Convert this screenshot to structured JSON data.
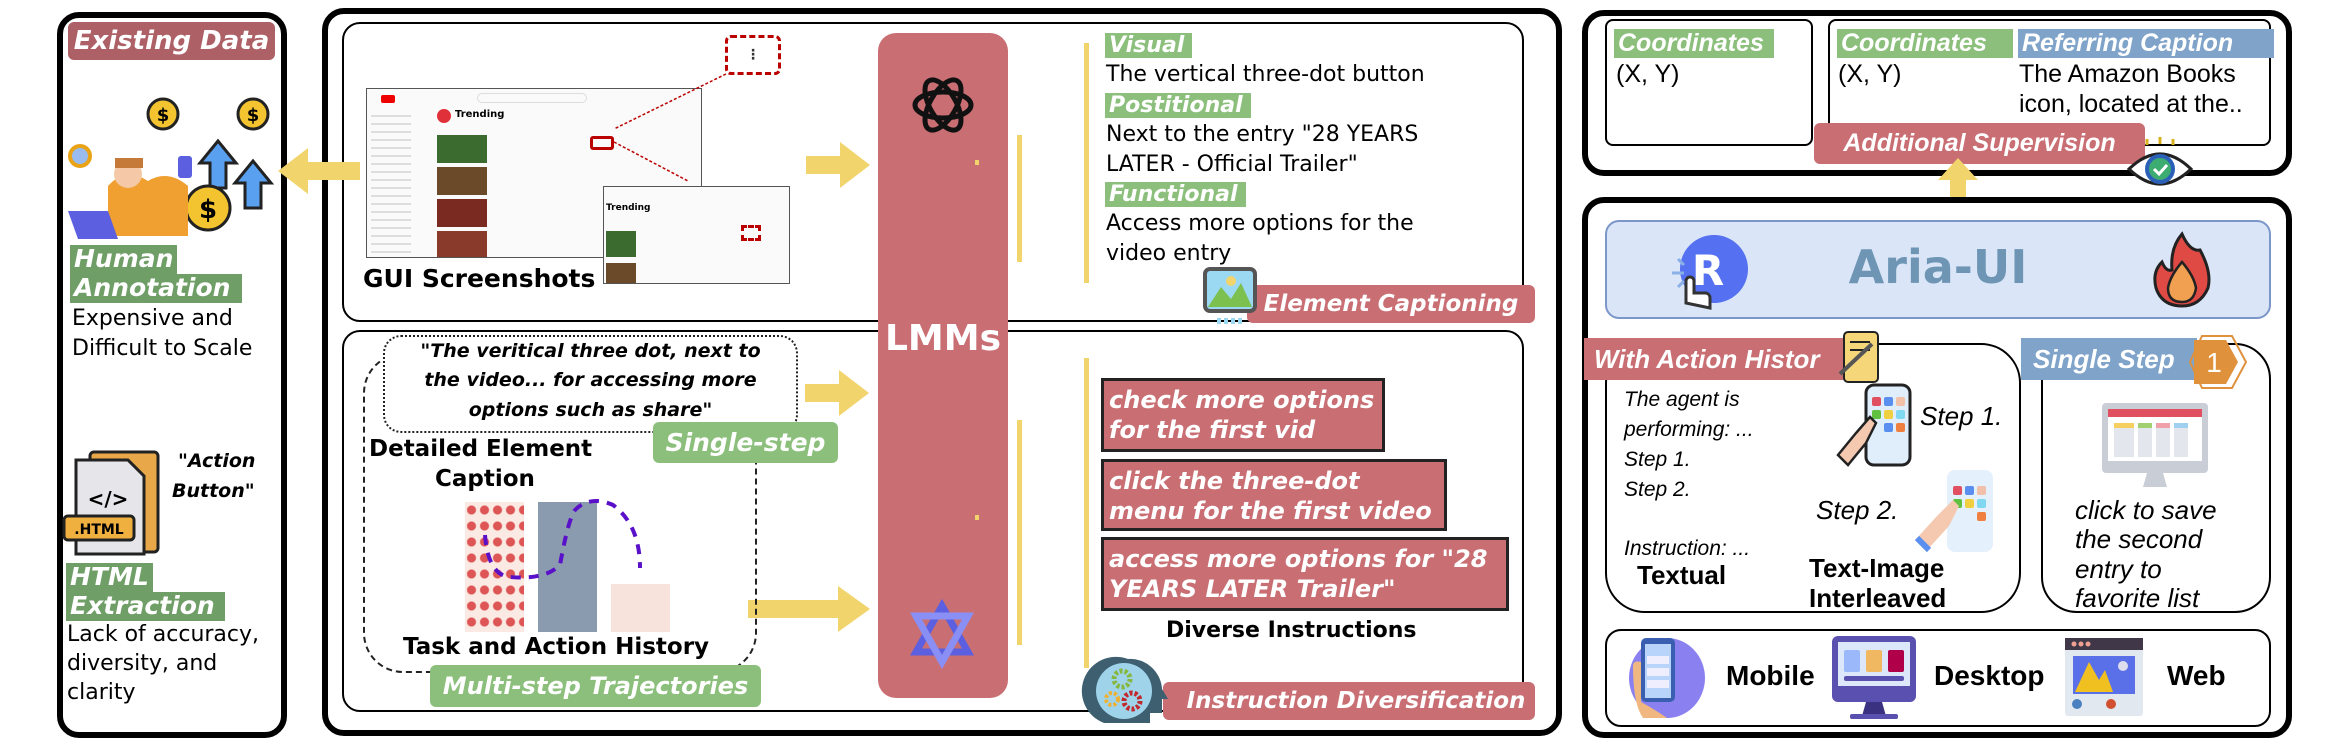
{
  "existing_data": {
    "title": "Existing Data",
    "human_annotation": {
      "label_line1": "Human",
      "label_line2": "Annotation",
      "desc_line1": "Expensive and",
      "desc_line2": "Difficult to Scale"
    },
    "html_extraction": {
      "icon_text": ".HTML",
      "quote_line1": "\"Action",
      "quote_line2": "Button\"",
      "label_line1": "HTML",
      "label_line2": "Extraction",
      "desc_line1": "Lack of accuracy,",
      "desc_line2": "diversity, and",
      "desc_line3": "clarity"
    }
  },
  "captioning": {
    "gui_label": "GUI Screenshots",
    "screenshot_title": "Trending",
    "visual_label": "Visual",
    "visual_text": "The vertical three-dot button",
    "positional_label": "Postitional",
    "positional_line1": "Next to the entry \"28 YEARS",
    "positional_line2": "LATER - Official Trailer\"",
    "functional_label": "Functional",
    "functional_line1": "Access more options for the",
    "functional_line2": "video entry",
    "badge": "Element Captioning"
  },
  "lmm": {
    "label": "LMMs"
  },
  "diversification": {
    "caption_line1": "\"The veritical three dot, next to",
    "caption_line2": "the video... for accessing more",
    "caption_line3": "options such as share\"",
    "single_step_badge": "Single-step",
    "detailed_line1": "Detailed Element",
    "detailed_line2": "Caption",
    "task_history": "Task and Action History",
    "multi_step_badge": "Multi-step Trajectories",
    "instructions": [
      {
        "line1": "check more options",
        "line2": "for the first vid"
      },
      {
        "line1": "click the three-dot",
        "line2": "menu for the first video"
      },
      {
        "line1": "access more options for \"28",
        "line2": "YEARS LATER Trailer\""
      }
    ],
    "instructions_label": "Diverse Instructions",
    "badge": "Instruction Diversification"
  },
  "supervision": {
    "coord_label": "Coordinates",
    "coord_value": "(X, Y)",
    "coord_label2": "Coordinates",
    "coord_value2": "(X, Y)",
    "ref_label": "Referring Caption",
    "ref_line1": "The Amazon Books",
    "ref_line2": "icon, located at the..",
    "badge": "Additional Supervision"
  },
  "aria": {
    "title": "Aria-UI",
    "with_history_badge": "With Action Histor",
    "textual_lines": [
      "The agent is",
      "performing: ...",
      "Step 1.",
      "Step 2."
    ],
    "instruction_text": "Instruction: ...",
    "textual_label": "Textual",
    "step1": "Step 1.",
    "step2": "Step 2.",
    "interleaved_line1": "Text-Image",
    "interleaved_line2": "Interleaved",
    "single_step_badge": "Single Step",
    "step_number": "1",
    "single_lines": [
      "click to save",
      "the second",
      "entry to",
      "favorite list"
    ],
    "platforms": [
      "Mobile",
      "Desktop",
      "Web"
    ]
  },
  "colors": {
    "red_badge": "#c96f74",
    "existing_header": "#ad6167",
    "green_label": "#8bbf7b",
    "blue_label": "#7fa3c9",
    "arrow_yellow": "#f2d46d",
    "aria_bg": "#dae6f8",
    "aria_text": "#6f95b5"
  }
}
